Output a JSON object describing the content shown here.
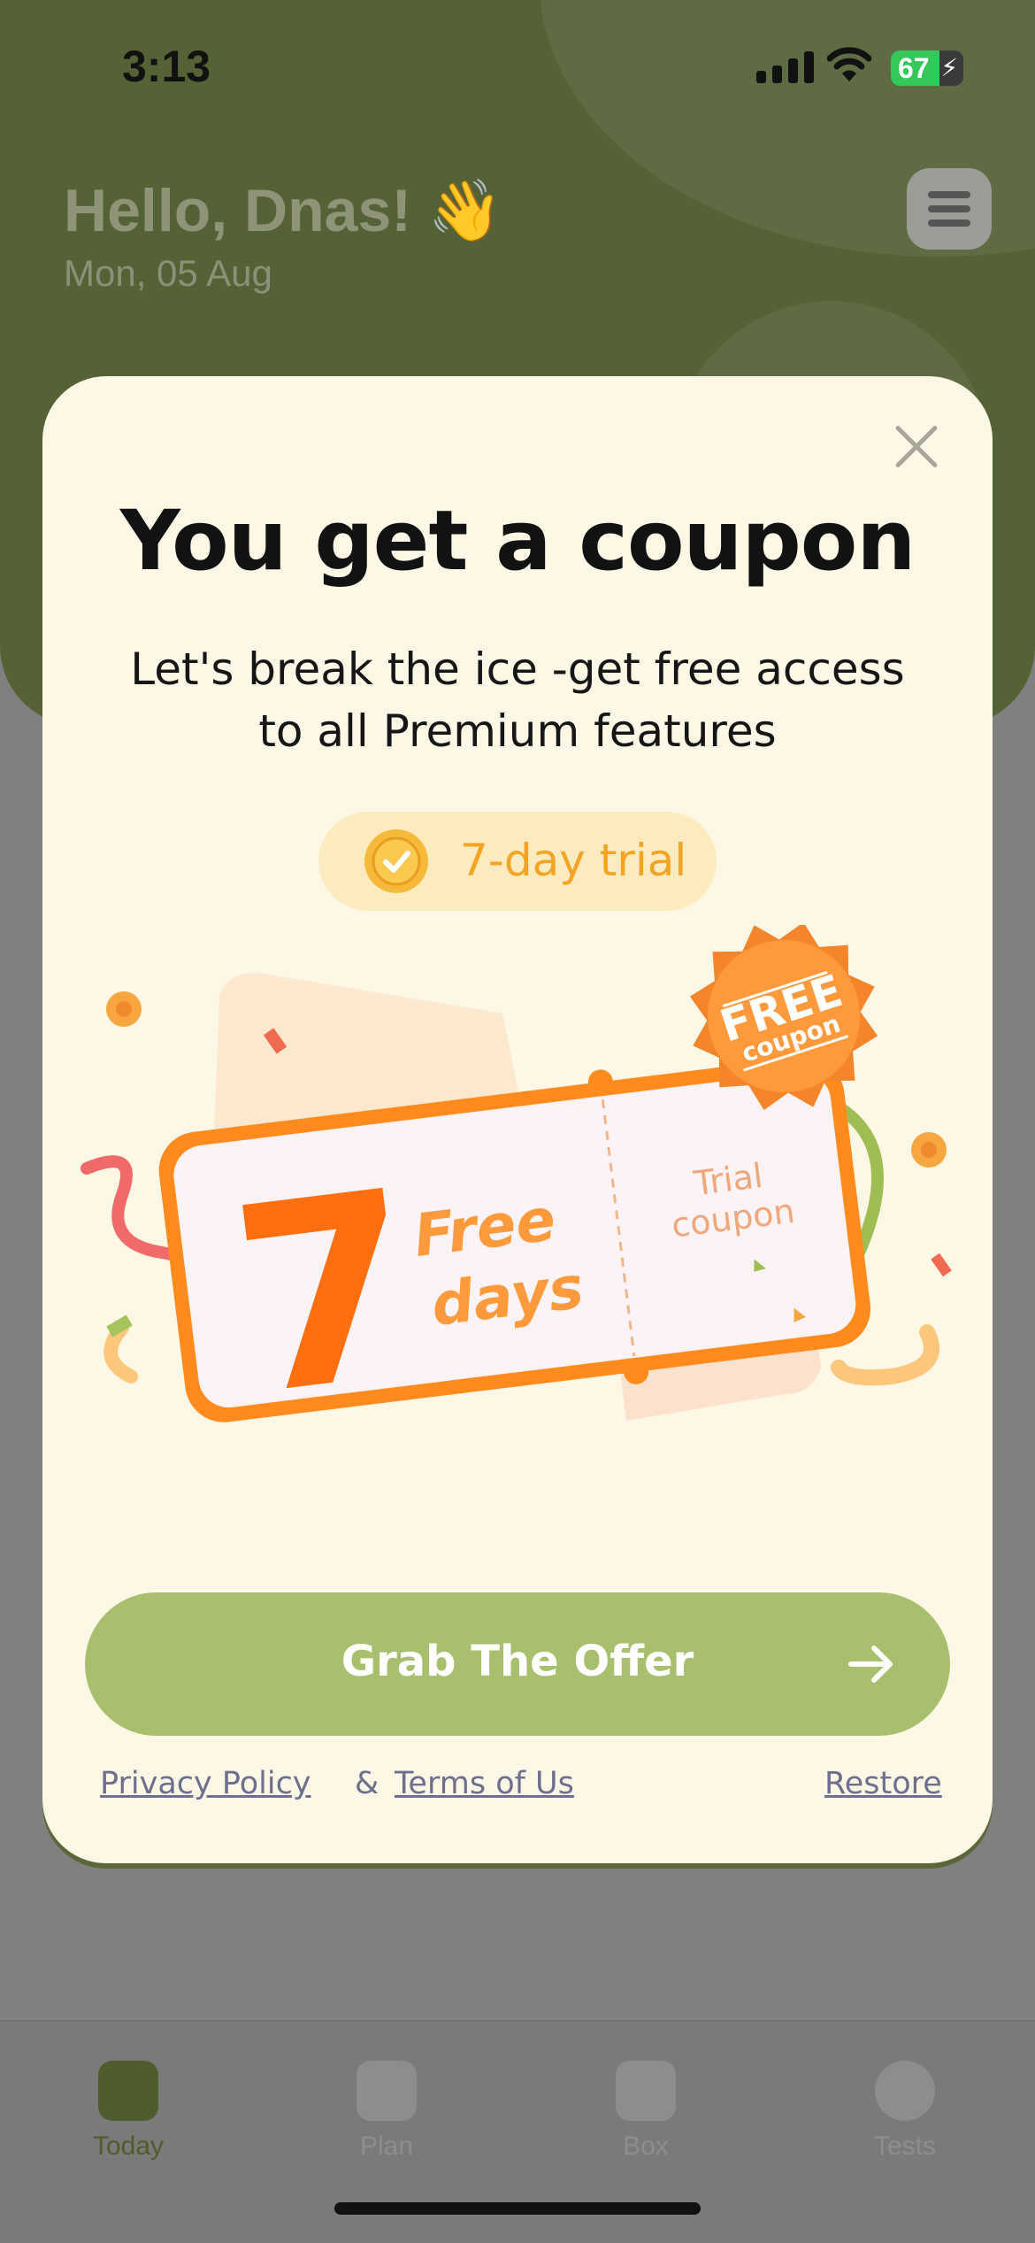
{
  "status_bar": {
    "time": "3:13",
    "battery": "67",
    "battery_level": 0.67
  },
  "header": {
    "greeting": "Hello, Dnas! 👋",
    "date": "Mon, 05 Aug"
  },
  "tabbar": {
    "items": [
      {
        "label": "Today",
        "icon": "calendar-icon",
        "active": true
      },
      {
        "label": "Plan",
        "icon": "clipboard-icon",
        "active": false
      },
      {
        "label": "Box",
        "icon": "box-icon",
        "active": false
      },
      {
        "label": "Tests",
        "icon": "checkmark-badge-icon",
        "active": false
      }
    ]
  },
  "modal": {
    "title": "You get a coupon",
    "subtitle_line1": "Let's break the ice -get free access",
    "subtitle_line2": "to all Premium features",
    "trial_pill": "7-day trial",
    "coupon": {
      "number": "7",
      "free": "Free",
      "days": "days",
      "stub_line1": "Trial",
      "stub_line2": "coupon",
      "badge_line1": "FREE",
      "badge_line2": "coupon"
    },
    "cta_label": "Grab The Offer",
    "privacy_link": "Privacy Policy",
    "ampersand": "&",
    "terms_link": "Terms of Us",
    "restore_link": "Restore"
  },
  "colors": {
    "header_green": "#556236",
    "cta_green": "#a8bf6d",
    "coupon_orange": "#ff8a1e",
    "trial_text": "#f3a424",
    "modal_bg": "#fdf8e6"
  }
}
